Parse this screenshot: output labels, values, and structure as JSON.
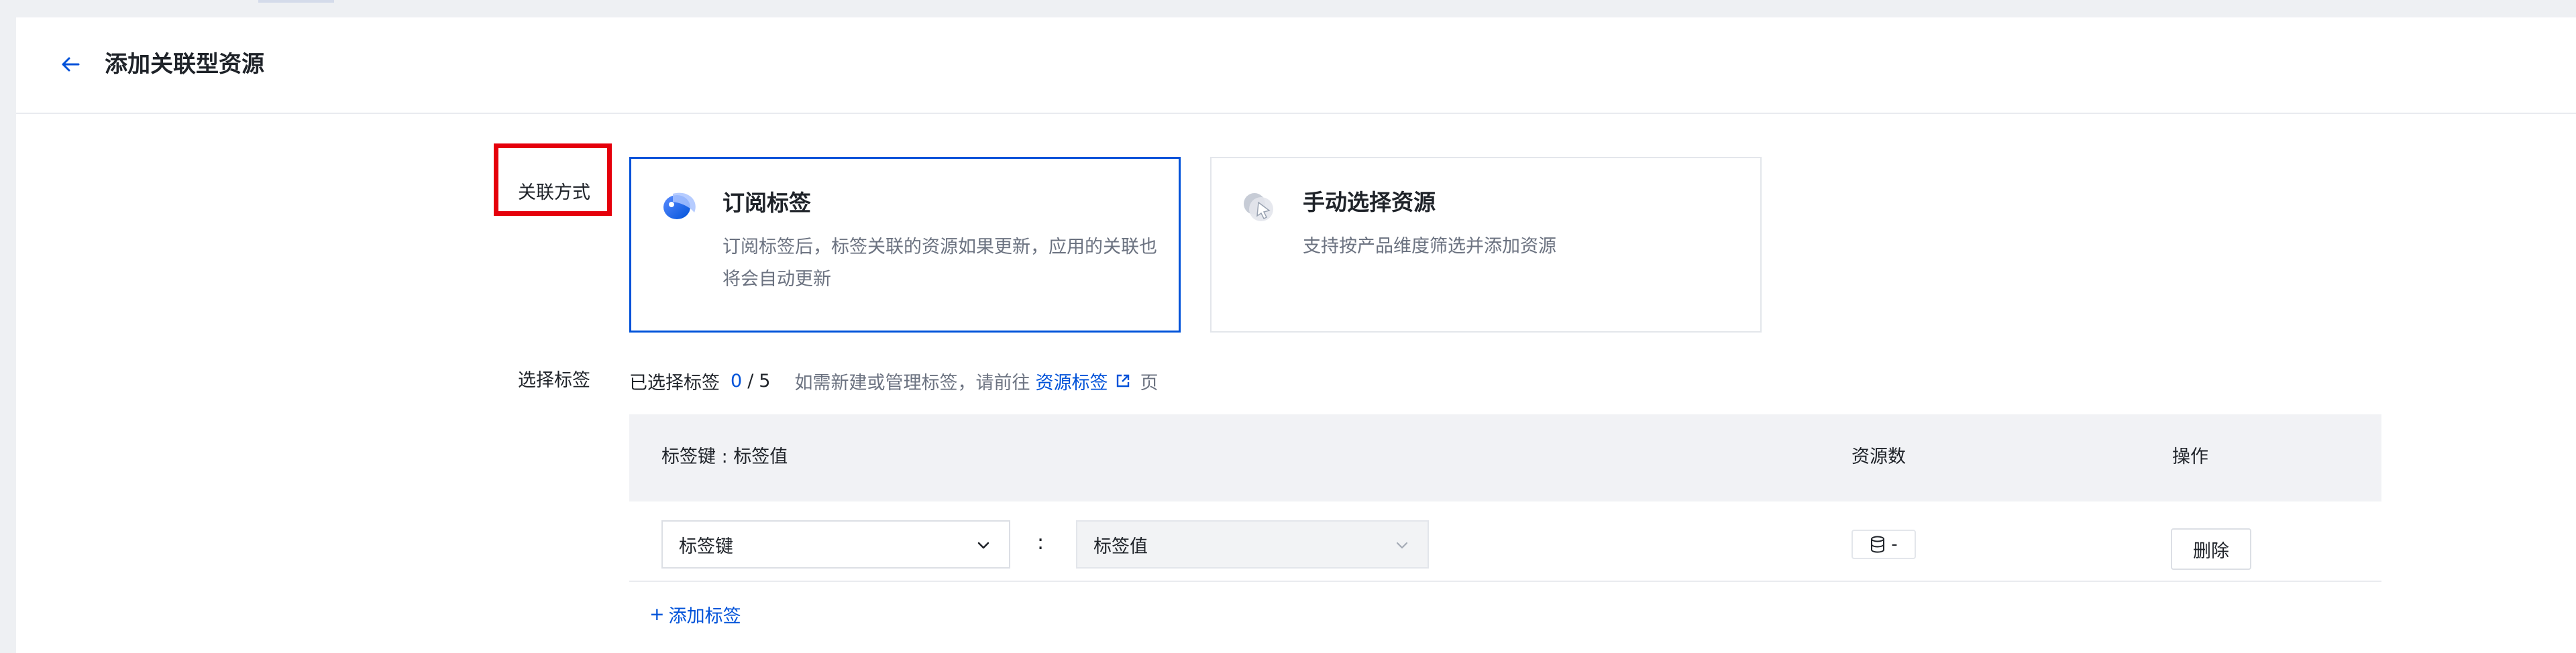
{
  "header": {
    "title": "添加关联型资源",
    "back_icon": "arrow-left-icon",
    "accent_color": "#0052d9"
  },
  "form": {
    "mode_label": "关联方式",
    "tags_label": "选择标签"
  },
  "cards": [
    {
      "title": "订阅标签",
      "desc": "订阅标签后，标签关联的资源如果更新，应用的关联也将会自动更新",
      "icon": "subscribe-tag-icon",
      "selected": true
    },
    {
      "title": "手动选择资源",
      "desc": "支持按产品维度筛选并添加资源",
      "icon": "manual-select-icon",
      "selected": false
    }
  ],
  "selection": {
    "label": "已选择标签",
    "count": "0",
    "separator": "/",
    "max": "5",
    "hint": "如需新建或管理标签，请前往",
    "link": "资源标签",
    "link_icon": "external-link-icon",
    "suffix": "页"
  },
  "table": {
    "headers": {
      "key_value": "标签键 : 标签值",
      "resource_count": "资源数",
      "operations": "操作"
    },
    "rows": [
      {
        "key_placeholder": "标签键",
        "colon": ":",
        "value_placeholder": "标签值",
        "count": "-",
        "count_icon": "database-icon",
        "delete_label": "删除"
      }
    ]
  },
  "add_tag": {
    "plus": "+",
    "label": "添加标签"
  }
}
